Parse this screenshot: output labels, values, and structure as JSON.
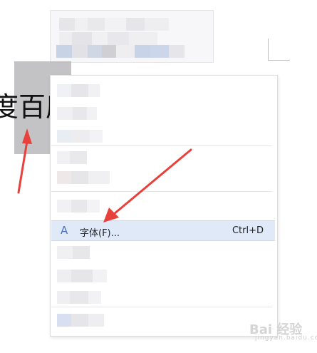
{
  "document": {
    "text": "度百度"
  },
  "context_menu": {
    "font_item": {
      "icon": "A",
      "label": "字体(F)...",
      "shortcut": "Ctrl+D"
    }
  },
  "annotation": {
    "arrow_color": "#e8403a"
  },
  "watermark": {
    "text": "Bai 经验",
    "sub": "jingyan.baidu.com"
  },
  "colors": {
    "highlight": "#dfe9f8",
    "selection": "#b9b9bb",
    "icon": "#4a72c4"
  }
}
